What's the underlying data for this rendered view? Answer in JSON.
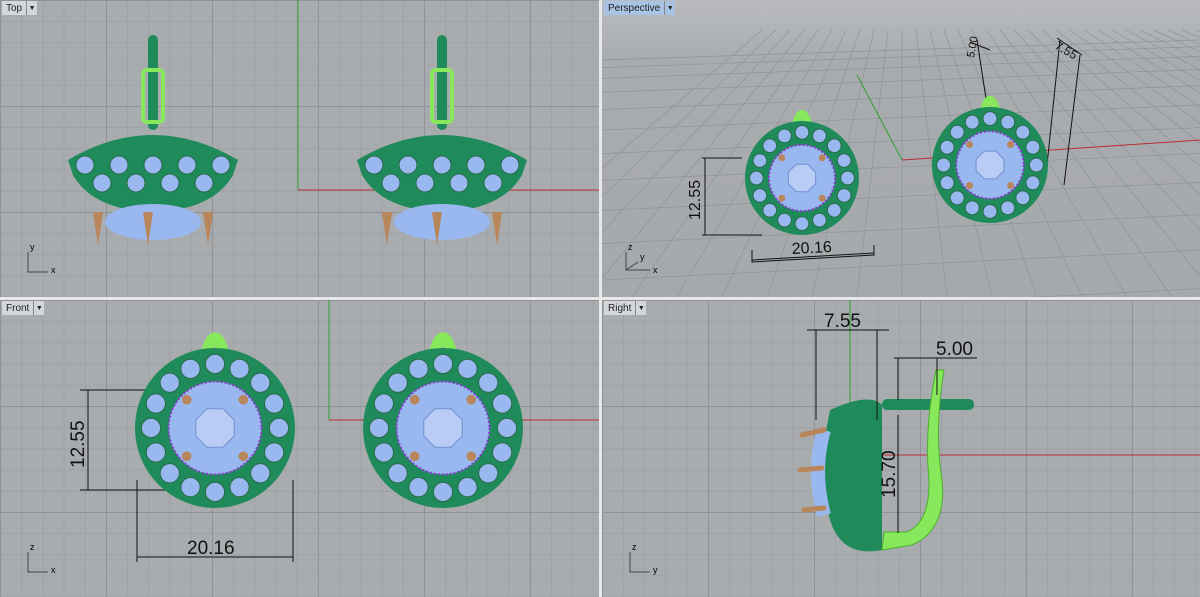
{
  "viewports": {
    "top": {
      "label": "Top",
      "axes": [
        "y",
        "x"
      ]
    },
    "perspective": {
      "label": "Perspective",
      "axes": [
        "z",
        "y",
        "x"
      ],
      "dimensions": [
        "12.55",
        "20.16",
        "5.00",
        "7.55"
      ]
    },
    "front": {
      "label": "Front",
      "axes": [
        "z",
        "x"
      ],
      "dimensions": [
        "12.55",
        "20.16"
      ]
    },
    "right": {
      "label": "Right",
      "axes": [
        "z",
        "y"
      ],
      "dimensions": [
        "7.55",
        "5.00",
        "15.70"
      ]
    }
  },
  "colors": {
    "metal": "#1f8a5a",
    "gem": "#9ab8f0",
    "prong": "#b8865a",
    "bail": "#86e85a",
    "x_axis": "#b83030",
    "y_axis": "#2ea02e"
  }
}
